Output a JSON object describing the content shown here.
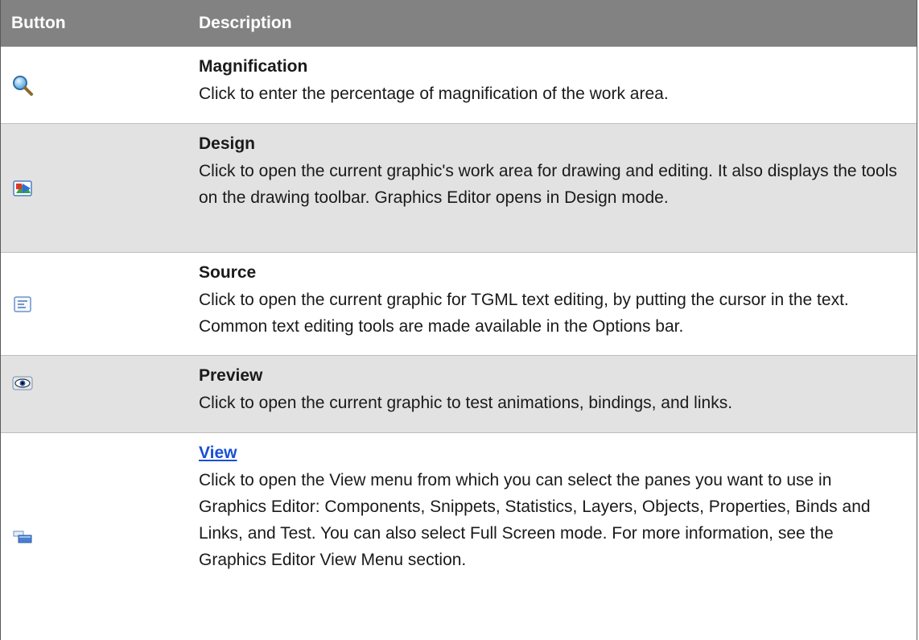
{
  "header": {
    "button": "Button",
    "description": "Description"
  },
  "rows": [
    {
      "icon": "magnifier-icon",
      "title": "Magnification",
      "description": "Click to enter the percentage of magnification of the work area."
    },
    {
      "icon": "design-icon",
      "title": "Design",
      "description": "Click to open the current graphic's work area for drawing and editing. It also displays the tools on the drawing toolbar. Graphics Editor opens in Design mode."
    },
    {
      "icon": "source-icon",
      "title": "Source",
      "description": "Click to open the current graphic for TGML text editing, by putting the cursor in the text. Common text editing tools are made available in the Options bar."
    },
    {
      "icon": "preview-eye-icon",
      "title": "Preview",
      "description": "Click to open the current graphic to test animations, bindings, and links."
    },
    {
      "icon": "view-panes-icon",
      "title": "View",
      "description": "Click to open the View menu from which you can select the panes you want to use in Graphics Editor: Components, Snippets, Statistics, Layers, Objects, Properties, Binds and Links, and Test. You can also select Full Screen mode. For more information, see the Graphics Editor View Menu section."
    }
  ],
  "colors": {
    "header_bg": "#828282",
    "alt_row_bg": "#e2e2e2",
    "link": "#1a4fd6"
  }
}
